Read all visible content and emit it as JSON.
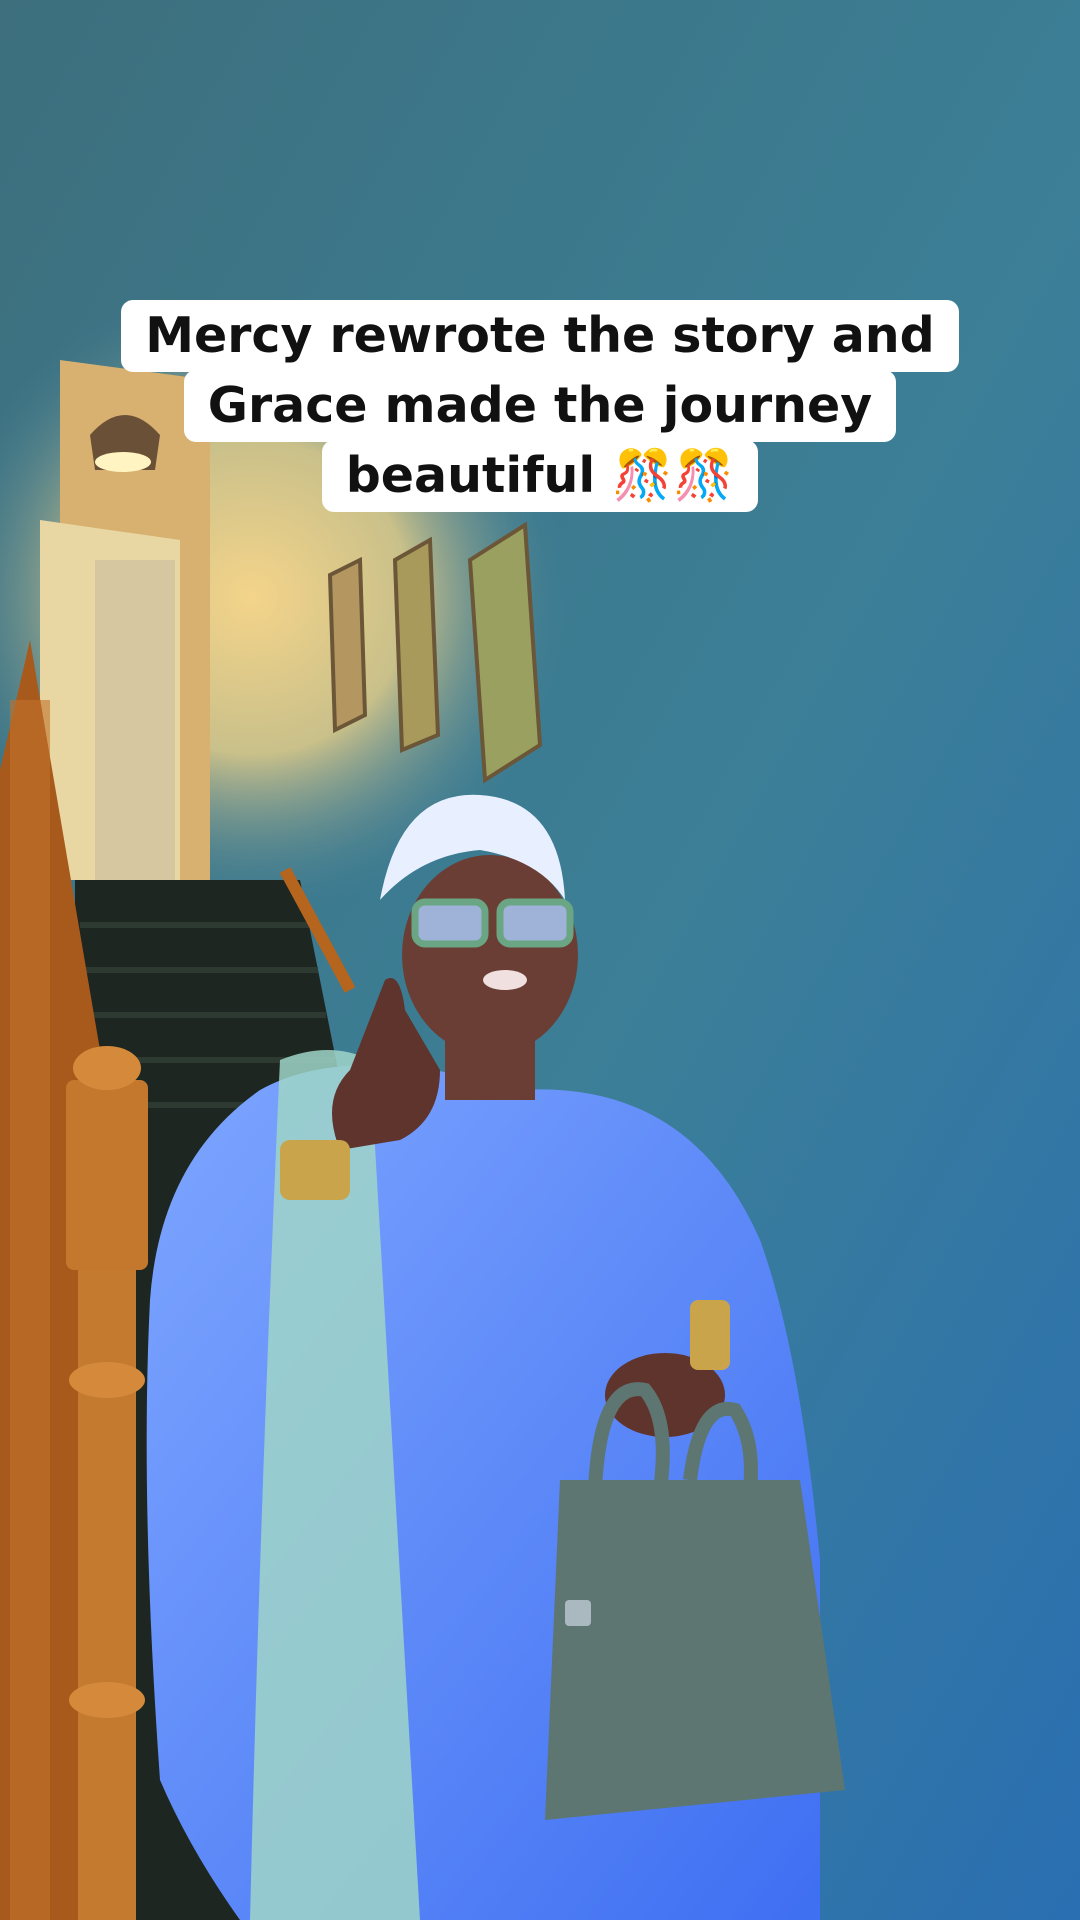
{
  "caption": {
    "line1": "Mercy rewrote the story and",
    "line2": "Grace made the journey",
    "line3": "beautiful 🎊🎊"
  },
  "colors": {
    "wall": "#2f6f86",
    "wall_warm": "#d6c27a",
    "banister": "#b5651d",
    "dress": "#5a8bff",
    "bag": "#5d7672",
    "caption_bg": "#ffffff",
    "caption_text": "#111111"
  }
}
